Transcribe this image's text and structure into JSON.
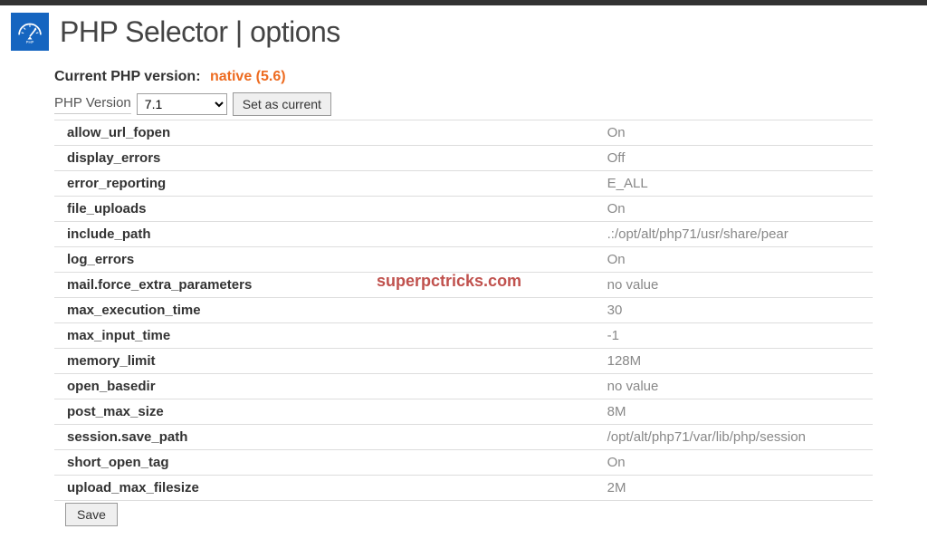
{
  "header": {
    "title": "PHP Selector | options"
  },
  "current_version": {
    "label": "Current PHP version:",
    "value": "native (5.6)"
  },
  "version_row": {
    "label": "PHP Version",
    "selected": "7.1",
    "button": "Set as current"
  },
  "options": [
    {
      "name": "allow_url_fopen",
      "value": "On"
    },
    {
      "name": "display_errors",
      "value": "Off"
    },
    {
      "name": "error_reporting",
      "value": "E_ALL"
    },
    {
      "name": "file_uploads",
      "value": "On"
    },
    {
      "name": "include_path",
      "value": ".:/opt/alt/php71/usr/share/pear"
    },
    {
      "name": "log_errors",
      "value": "On"
    },
    {
      "name": "mail.force_extra_parameters",
      "value": "no value"
    },
    {
      "name": "max_execution_time",
      "value": "30"
    },
    {
      "name": "max_input_time",
      "value": "-1"
    },
    {
      "name": "memory_limit",
      "value": "128M"
    },
    {
      "name": "open_basedir",
      "value": "no value"
    },
    {
      "name": "post_max_size",
      "value": "8M"
    },
    {
      "name": "session.save_path",
      "value": "/opt/alt/php71/var/lib/php/session"
    },
    {
      "name": "short_open_tag",
      "value": "On"
    },
    {
      "name": "upload_max_filesize",
      "value": "2M"
    }
  ],
  "save_button": "Save",
  "watermark": "superpctricks.com"
}
